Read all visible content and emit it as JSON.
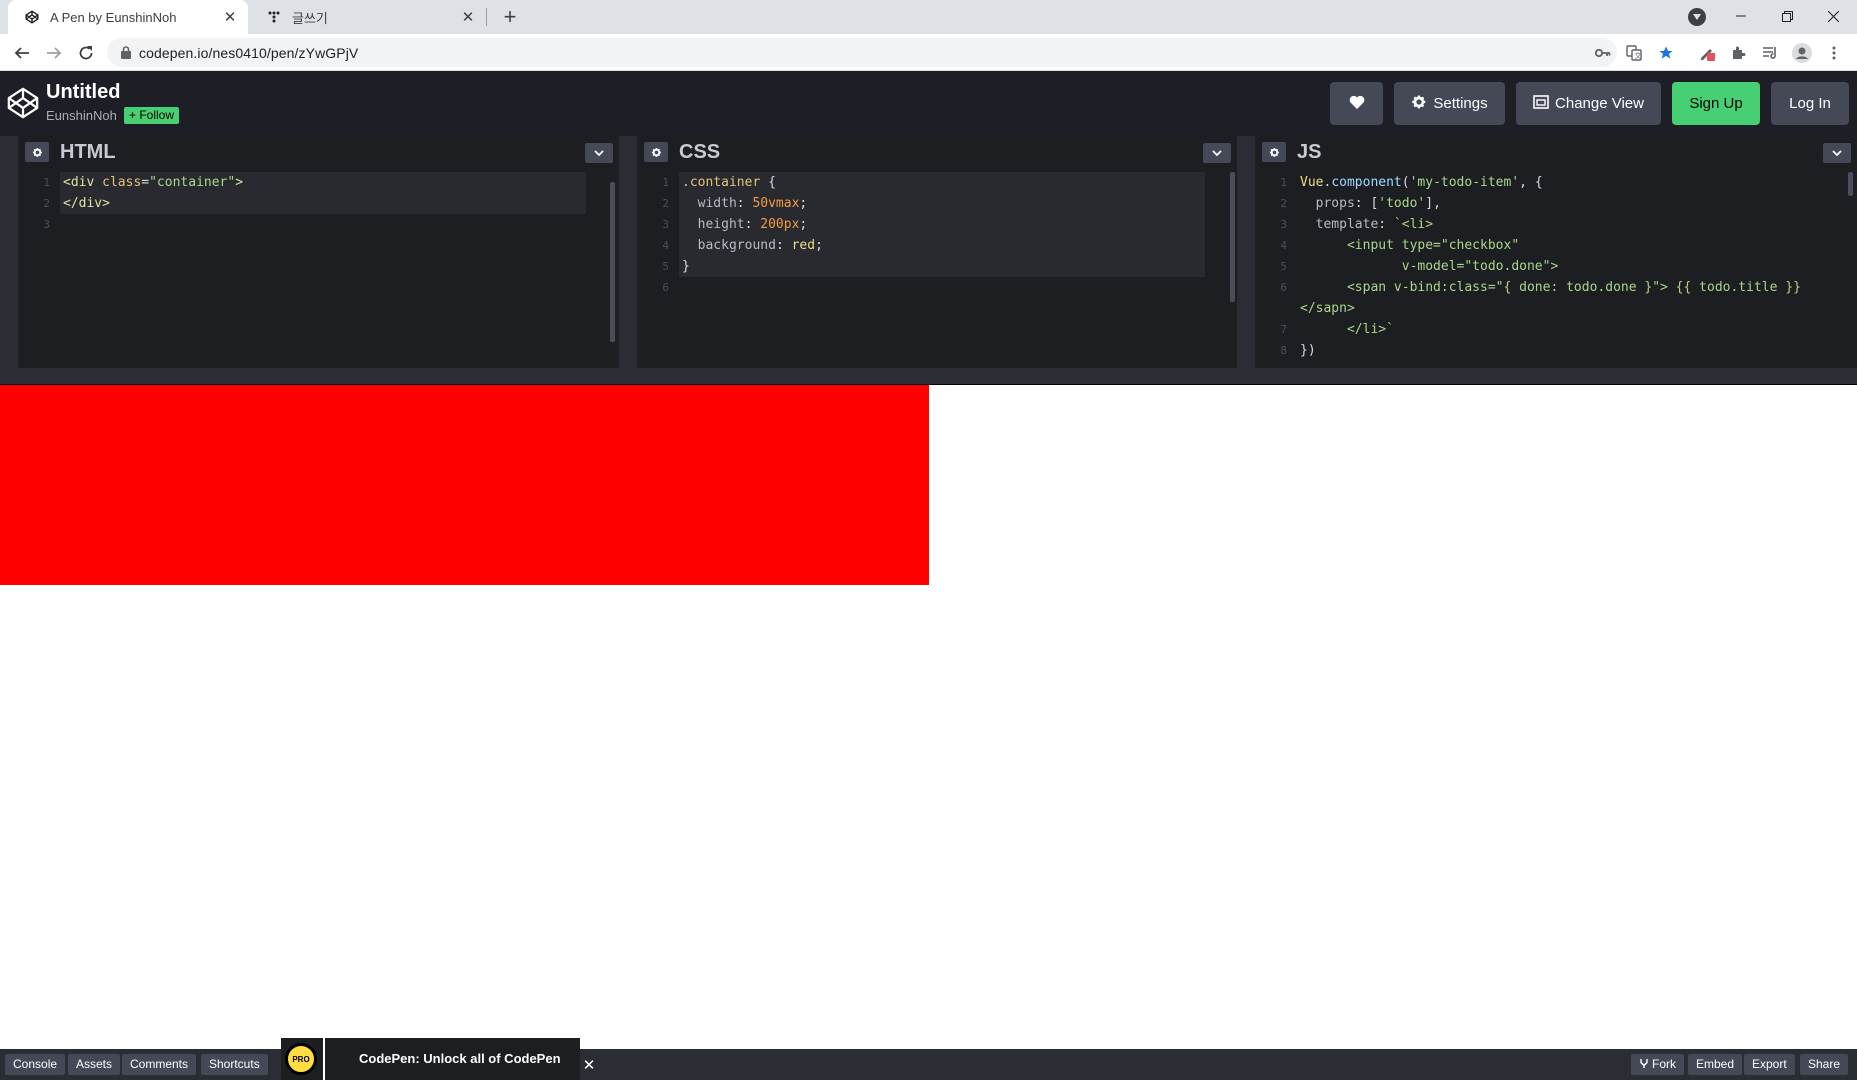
{
  "browser": {
    "tabs": [
      {
        "title": "A Pen by EunshinNoh",
        "active": true
      },
      {
        "title": "글쓰기",
        "active": false
      }
    ],
    "new_tab_icon": "plus-icon",
    "url": "codepen.io/nes0410/pen/zYwGPjV"
  },
  "header": {
    "title": "Untitled",
    "author": "EunshinNoh",
    "follow_label": "+ Follow",
    "settings_label": "Settings",
    "change_view_label": "Change View",
    "signup_label": "Sign Up",
    "login_label": "Log In"
  },
  "editors": {
    "html": {
      "name": "HTML",
      "lines": [
        {
          "n": "1",
          "code": "<div class=\"container\">"
        },
        {
          "n": "2",
          "code": "</div>"
        },
        {
          "n": "3",
          "code": ""
        }
      ]
    },
    "css": {
      "name": "CSS",
      "lines": [
        {
          "n": "1",
          "code": ".container {"
        },
        {
          "n": "2",
          "code": "  width: 50vmax;"
        },
        {
          "n": "3",
          "code": "  height: 200px;"
        },
        {
          "n": "4",
          "code": "  background: red;"
        },
        {
          "n": "5",
          "code": "}"
        },
        {
          "n": "6",
          "code": ""
        }
      ]
    },
    "js": {
      "name": "JS",
      "lines": [
        {
          "n": "1",
          "code": "Vue.component('my-todo-item', {"
        },
        {
          "n": "2",
          "code": "  props: ['todo'],"
        },
        {
          "n": "3",
          "code": "  template: `<li>"
        },
        {
          "n": "4",
          "code": "      <input type=\"checkbox\""
        },
        {
          "n": "5",
          "code": "             v-model=\"todo.done\">"
        },
        {
          "n": "6",
          "code": "      <span v-bind:class=\"{ done: todo.done }\"> {{ todo.title }}"
        },
        {
          "n": "",
          "code": "</sapn>"
        },
        {
          "n": "7",
          "code": "      </li>`"
        },
        {
          "n": "8",
          "code": "})"
        }
      ]
    }
  },
  "preview": {
    "box_color": "#ff0000"
  },
  "footer": {
    "left_buttons": [
      "Console",
      "Assets",
      "Comments",
      "Shortcuts"
    ],
    "promo_badge": "PRO",
    "promo_text": "CodePen: Unlock all of CodePen",
    "right_buttons": [
      "Fork",
      "Embed",
      "Export",
      "Share"
    ]
  },
  "colors": {
    "accent_green": "#47cf73",
    "editor_bg": "#1d1e22",
    "header_bg": "#1e1f26"
  }
}
